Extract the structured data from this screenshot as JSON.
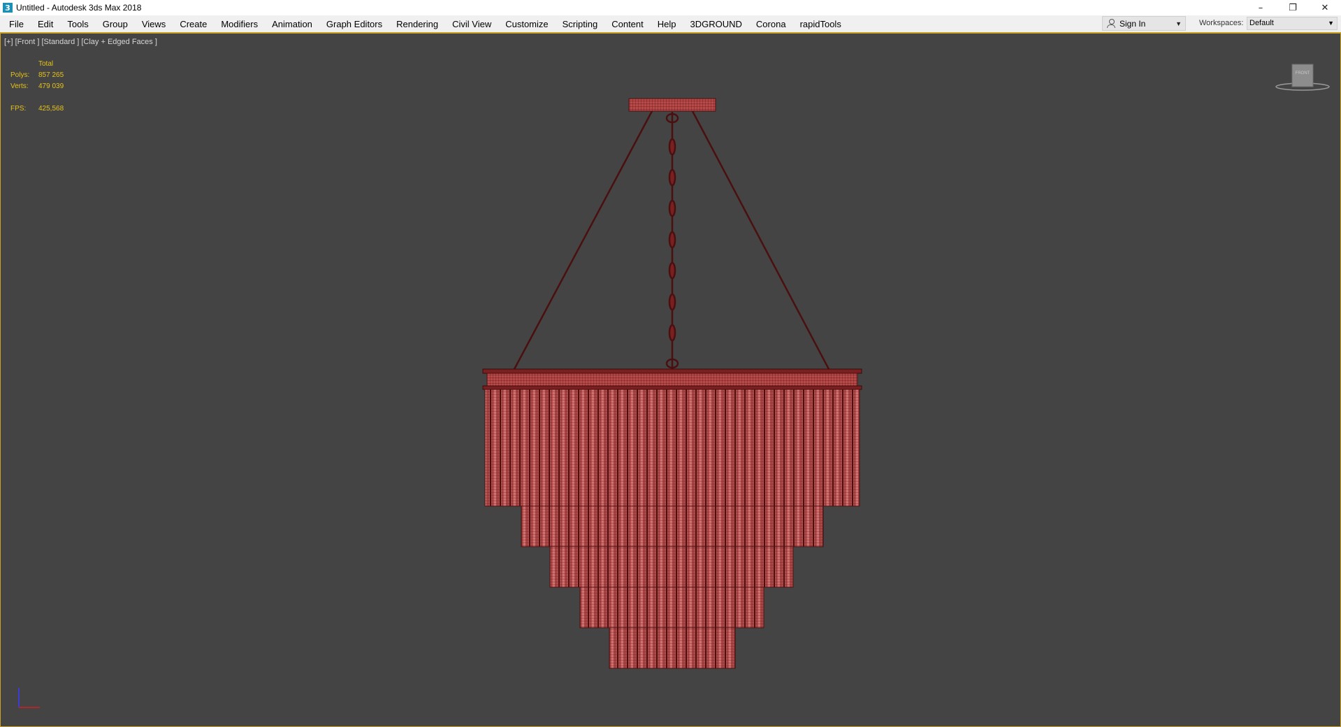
{
  "window": {
    "title": "Untitled - Autodesk 3ds Max 2018",
    "app_icon_glyph": "3",
    "controls": {
      "minimize": "–",
      "restore": "❐",
      "close": "✕"
    }
  },
  "menu": {
    "items": [
      "File",
      "Edit",
      "Tools",
      "Group",
      "Views",
      "Create",
      "Modifiers",
      "Animation",
      "Graph Editors",
      "Rendering",
      "Civil View",
      "Customize",
      "Scripting",
      "Content",
      "Help",
      "3DGROUND",
      "Corona",
      "rapidTools"
    ]
  },
  "account": {
    "signin_label": "Sign In"
  },
  "workspaces": {
    "label": "Workspaces:",
    "value": "Default"
  },
  "viewport": {
    "label": "[+] [Front ] [Standard ] [Clay + Edged Faces ]",
    "stats": {
      "header": "Total",
      "polys_label": "Polys:",
      "polys_value": "857 265",
      "verts_label": "Verts:",
      "verts_value": "479 039",
      "fps_label": "FPS:",
      "fps_value": "425,568"
    },
    "viewcube_label": "FRONT"
  },
  "colors": {
    "viewport_bg": "#444444",
    "mesh_fill": "#b84a4a",
    "mesh_wire": "#4a1010",
    "stats_text": "#e6c21a",
    "active_border": "#c9a227"
  }
}
